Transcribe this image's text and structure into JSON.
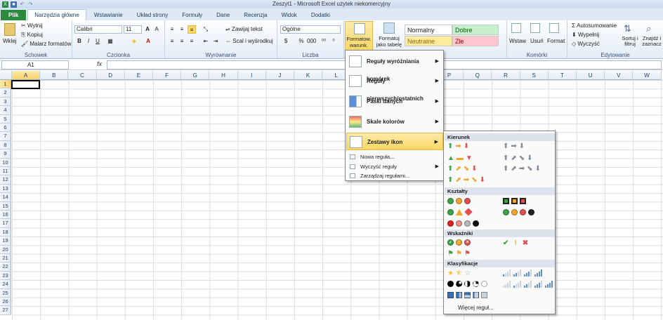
{
  "window": {
    "title": "Zeszyt1 - Microsoft Excel użytek niekomercyjny"
  },
  "tabs": [
    "Plik",
    "Narzędzia główne",
    "Wstawianie",
    "Układ strony",
    "Formuły",
    "Dane",
    "Recenzja",
    "Widok",
    "Dodatki"
  ],
  "ribbon": {
    "clipboard": {
      "paste": "Wklej",
      "cut": "Wytnij",
      "copy": "Kopiuj",
      "painter": "Malarz formatów",
      "label": "Schowek"
    },
    "font": {
      "name": "Calibri",
      "size": "11",
      "label": "Czcionka"
    },
    "alignment": {
      "wrap": "Zawijaj tekst",
      "merge": "Scal i wyśrodkuj",
      "label": "Wyrównanie"
    },
    "number": {
      "format": "Ogólne",
      "label": "Liczba"
    },
    "styles": {
      "cond_format": "Formatow. warunk.",
      "table_format": "Formatuj jako tabelę",
      "normal": "Normalny",
      "good": "Dobre",
      "neutral": "Neutralne",
      "bad": "Złe"
    },
    "cells": {
      "insert": "Wstaw",
      "delete": "Usuń",
      "format": "Format",
      "label": "Komórki"
    },
    "editing": {
      "autosum": "Autosumowanie",
      "fill": "Wypełnij",
      "clear": "Wyczyść",
      "sort": "Sortuj i filtruj",
      "find": "Znajdź i zaznacz",
      "label": "Edytowanie"
    }
  },
  "formula_bar": {
    "name_box": "A1",
    "fx": "fx"
  },
  "columns": [
    "A",
    "B",
    "C",
    "D",
    "E",
    "F",
    "G",
    "H",
    "I",
    "J",
    "K",
    "L",
    "M",
    "N",
    "O",
    "P",
    "Q",
    "R",
    "S",
    "T",
    "U",
    "V",
    "W"
  ],
  "rows": [
    "1",
    "2",
    "3",
    "4",
    "5",
    "6",
    "7",
    "8",
    "9",
    "10",
    "11",
    "12",
    "13",
    "14",
    "15",
    "16",
    "17",
    "18",
    "19",
    "20",
    "21",
    "22",
    "23",
    "24",
    "25",
    "26",
    "27"
  ],
  "menu": {
    "items": [
      "Reguły wyróżniania komórek",
      "Reguły pierwszych/ostatnich",
      "Paski danych",
      "Skale kolorów",
      "Zestawy ikon"
    ],
    "small": [
      "Nowa reguła...",
      "Wyczyść reguły",
      "Zarządzaj regułami..."
    ]
  },
  "submenu": {
    "sections": [
      "Kierunek",
      "Kształty",
      "Wskaźniki",
      "Klasyfikacje"
    ],
    "more": "Więcej reguł..."
  },
  "colors": {
    "accent": "#fbd764",
    "file_tab": "#2a8a3e",
    "green": "#3aa345",
    "yellow": "#f3a52b",
    "red": "#e05050"
  }
}
